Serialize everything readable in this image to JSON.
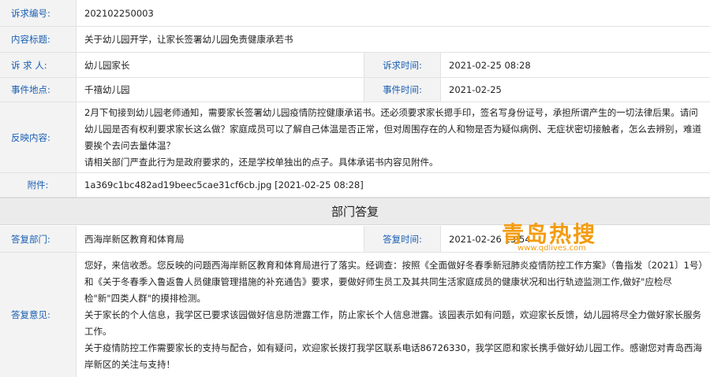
{
  "rows": {
    "case_no": {
      "label": "诉求编号:",
      "value": "202102250003"
    },
    "title": {
      "label": "内容标题:",
      "value": "关于幼儿园开学，让家长签署幼儿园免责健康承若书"
    },
    "requester": {
      "label": "诉 求 人:",
      "value": "幼儿园家长",
      "label2": "诉求时间:",
      "value2": "2021-02-25 08:28"
    },
    "location": {
      "label": "事件地点:",
      "value": "千禧幼儿园",
      "label2": "事件时间:",
      "value2": "2021-02-25"
    },
    "content": {
      "label": "反映内容:",
      "lines": [
        "2月下旬接到幼儿园老师通知，需要家长签署幼儿园疫情防控健康承诺书。还必须要求家长摁手印，签名写身份证号，承担所谓产生的一切法律后果。请问幼儿园是否有权利要求家长这么做？家庭成员可以了解自己体温是否正常，但对周围存在的人和物是否为疑似病例、无症状密切接触者，怎么去辨别，难道要挨个去问去量体温？",
        "请相关部门严查此行为是政府要求的，还是学校单独出的点子。具体承诺书内容见附件。"
      ]
    },
    "attachment": {
      "label": "附件:",
      "value": "1a369c1bc482ad19beec5cae31cf6cb.jpg [2021-02-25 08:28]"
    }
  },
  "section_title": "部门答复",
  "reply": {
    "dept": {
      "label": "答复部门:",
      "value": "西海岸新区教育和体育局",
      "label2": "答复时间:",
      "value2": "2021-02-26 13:54"
    },
    "opinion": {
      "label": "答复意见:",
      "lines": [
        "您好，来信收悉。您反映的问题西海岸新区教育和体育局进行了落实。经调查：按照《全面做好冬春季新冠肺炎疫情防控工作方案》（鲁指发〔2021〕1号）和《关于冬春季入鲁返鲁人员健康管理措施的补充通告》要求，要做好师生员工及其共同生活家庭成员的健康状况和出行轨迹监测工作,做好\"应检尽检\"新\"四类人群\"的摸排检测。",
        "关于家长的个人信息，我学区已要求该园做好信息防泄露工作，防止家长个人信息泄露。该园表示如有问题，欢迎家长反馈，幼儿园将尽全力做好家长服务工作。",
        "关于疫情防控工作需要家长的支持与配合，如有疑问，欢迎家长拨打我学区联系电话86726330，我学区愿和家长携手做好幼儿园工作。感谢您对青岛西海岸新区的关注与支持！"
      ]
    }
  },
  "watermark": {
    "title": "青岛热搜",
    "url": "www.qdlives.com",
    "color": "#f39c12"
  }
}
